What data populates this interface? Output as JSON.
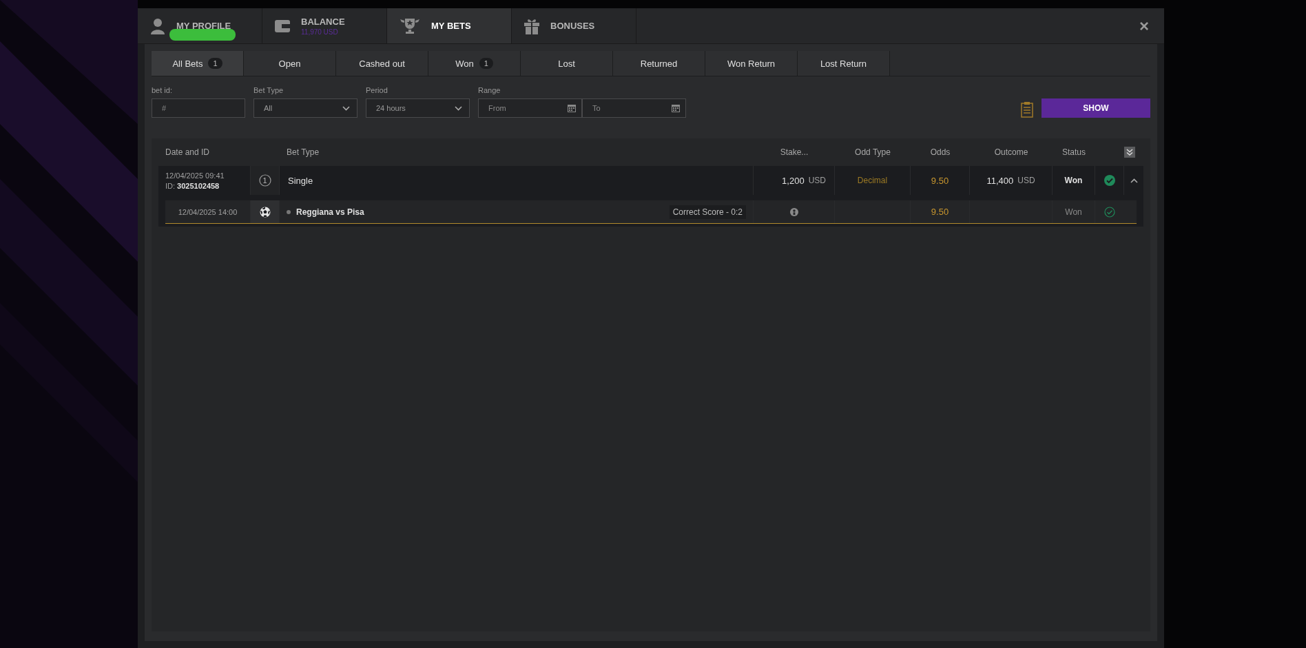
{
  "header_tabs": [
    {
      "kind": "profile",
      "label": "MY PROFILE",
      "redacted": true,
      "selected": false
    },
    {
      "kind": "balance",
      "label": "BALANCE",
      "subtext": "11,970 USD",
      "selected": false
    },
    {
      "kind": "bets",
      "label": "MY BETS",
      "selected": true
    },
    {
      "kind": "bonuses",
      "label": "BONUSES",
      "selected": false
    }
  ],
  "close": "×",
  "filter_tabs": [
    {
      "label": "All Bets",
      "count": "1",
      "selected": true
    },
    {
      "label": "Open",
      "selected": false
    },
    {
      "label": "Cashed out",
      "selected": false
    },
    {
      "label": "Won",
      "count": "1",
      "selected": false
    },
    {
      "label": "Lost",
      "selected": false
    },
    {
      "label": "Returned",
      "selected": false
    },
    {
      "label": "Won Return",
      "selected": false
    },
    {
      "label": "Lost Return",
      "selected": false
    }
  ],
  "filters": {
    "bet_id": {
      "label": "bet id:",
      "placeholder": "#"
    },
    "bet_type": {
      "label": "Bet Type",
      "value": "All"
    },
    "period": {
      "label": "Period",
      "value": "24 hours"
    },
    "range": {
      "label": "Range",
      "from": {
        "placeholder": "From"
      },
      "to": {
        "placeholder": "To"
      }
    },
    "show_button": "SHOW"
  },
  "table": {
    "columns": [
      "Date and ID",
      "Bet Type",
      "Stake...",
      "Odd Type",
      "Odds",
      "Outcome",
      "Status"
    ],
    "rows": [
      {
        "date": "12/04/2025 09:41",
        "id_label": "ID:",
        "id": "3025102458",
        "count": "1",
        "bet_type": "Single",
        "stake": "1,200",
        "stake_currency": "USD",
        "odd_type": "Decimal",
        "odds": "9.50",
        "outcome": "11,400",
        "outcome_currency": "USD",
        "status": "Won",
        "won": true,
        "expanded": true,
        "events": [
          {
            "date": "12/04/2025 14:00",
            "event": "Reggiana vs Pisa",
            "market": "Correct Score - 0:2",
            "odds": "9.50",
            "status": "Won",
            "won": true
          }
        ]
      }
    ]
  }
}
